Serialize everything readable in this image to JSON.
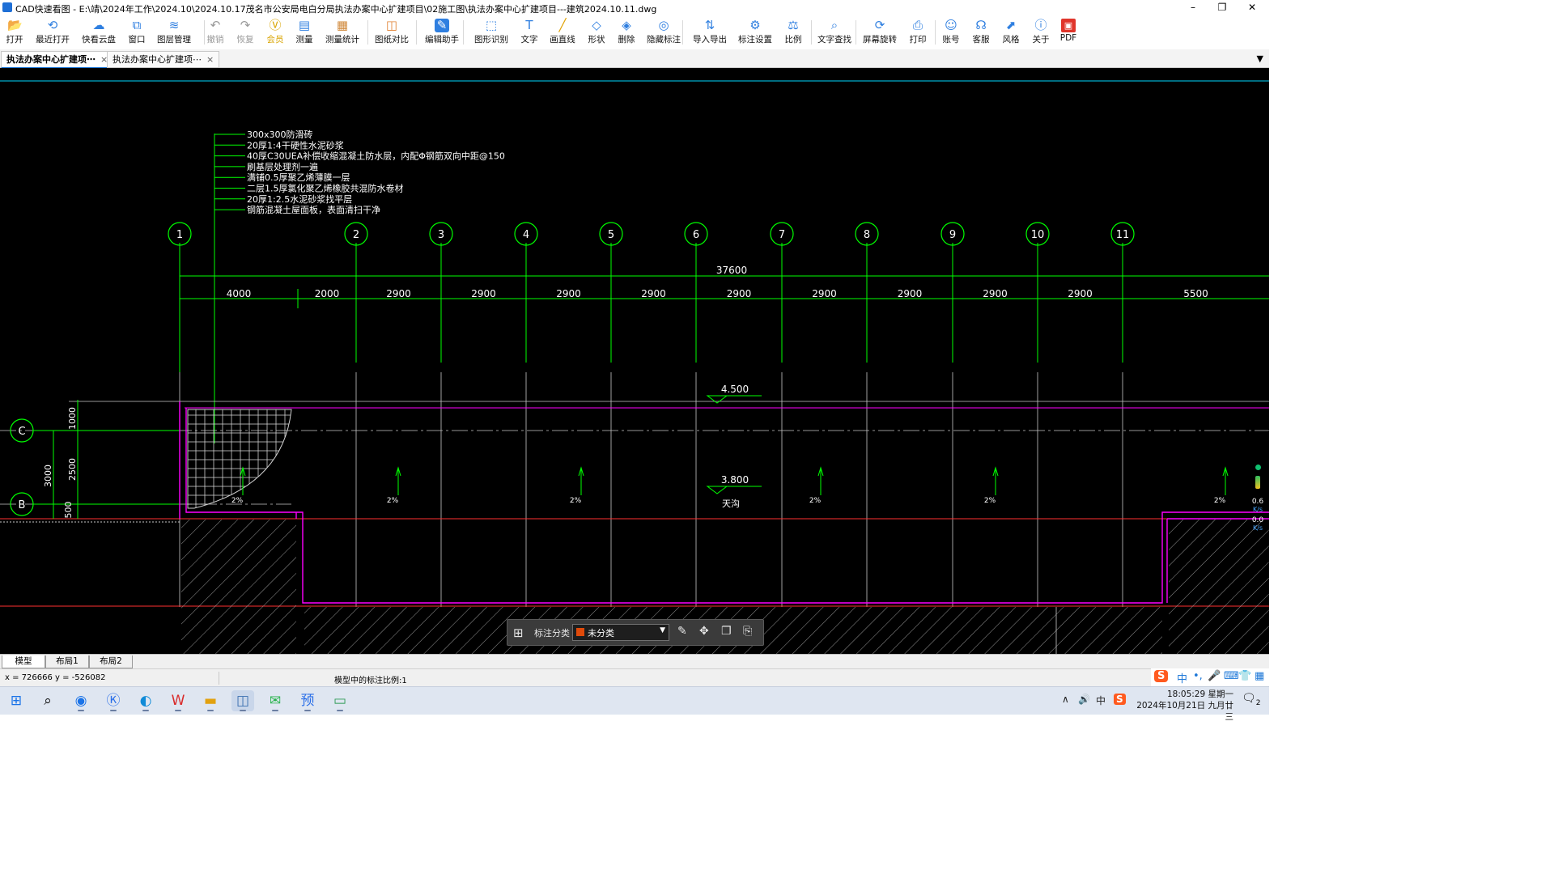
{
  "window": {
    "title": "CAD快速看图 - E:\\靖\\2024年工作\\2024.10\\2024.10.17茂名市公安局电白分局执法办案中心扩建项目\\02施工图\\执法办案中心扩建项目---建筑2024.10.11.dwg",
    "controls": {
      "minimize": "–",
      "restore": "❐",
      "close": "✕"
    }
  },
  "ribbon": {
    "buttons": [
      {
        "id": "open",
        "label": "打开",
        "icon": "folder-open-icon",
        "glyph": "📂"
      },
      {
        "id": "recent",
        "label": "最近打开",
        "icon": "history-icon",
        "glyph": "⟲"
      },
      {
        "id": "cloud",
        "label": "快看云盘",
        "icon": "cloud-icon",
        "glyph": "☁"
      },
      {
        "id": "window",
        "label": "窗口",
        "icon": "window-icon",
        "glyph": "⧉"
      },
      {
        "id": "layers",
        "label": "图层管理",
        "icon": "layers-icon",
        "glyph": "≋"
      },
      {
        "id": "undo",
        "label": "撤销",
        "icon": "undo-icon",
        "glyph": "↶"
      },
      {
        "id": "redo",
        "label": "恢复",
        "icon": "redo-icon",
        "glyph": "↷"
      },
      {
        "id": "vip",
        "label": "会员",
        "icon": "vip-icon",
        "glyph": "Ⓥ"
      },
      {
        "id": "measure",
        "label": "测量",
        "icon": "ruler-icon",
        "glyph": "▤"
      },
      {
        "id": "measure-stats",
        "label": "测量统计",
        "icon": "stats-icon",
        "glyph": "▦"
      },
      {
        "id": "compare",
        "label": "图纸对比",
        "icon": "compare-icon",
        "glyph": "◫"
      },
      {
        "id": "edit-assist",
        "label": "编辑助手",
        "icon": "edit-assist-icon",
        "glyph": "✎"
      },
      {
        "id": "shape-recog",
        "label": "图形识别",
        "icon": "shape-recognition-icon",
        "glyph": "⬚"
      },
      {
        "id": "text",
        "label": "文字",
        "icon": "text-icon",
        "glyph": "T"
      },
      {
        "id": "line",
        "label": "画直线",
        "icon": "line-icon",
        "glyph": "╱"
      },
      {
        "id": "shape",
        "label": "形状",
        "icon": "shape-icon",
        "glyph": "◇"
      },
      {
        "id": "erase",
        "label": "删除",
        "icon": "eraser-icon",
        "glyph": "◈"
      },
      {
        "id": "hide-annot",
        "label": "隐藏标注",
        "icon": "eye-hide-icon",
        "glyph": "◎"
      },
      {
        "id": "import-export",
        "label": "导入导出",
        "icon": "import-export-icon",
        "glyph": "⇅"
      },
      {
        "id": "annot-settings",
        "label": "标注设置",
        "icon": "annotation-settings-icon",
        "glyph": "⚙"
      },
      {
        "id": "scale",
        "label": "比例",
        "icon": "scale-icon",
        "glyph": "⚖"
      },
      {
        "id": "text-search",
        "label": "文字查找",
        "icon": "search-icon",
        "glyph": "⌕"
      },
      {
        "id": "rotate",
        "label": "屏幕旋转",
        "icon": "rotate-icon",
        "glyph": "⟳"
      },
      {
        "id": "print",
        "label": "打印",
        "icon": "print-icon",
        "glyph": "⎙"
      },
      {
        "id": "account",
        "label": "账号",
        "icon": "user-icon",
        "glyph": "☺"
      },
      {
        "id": "support",
        "label": "客服",
        "icon": "headset-icon",
        "glyph": "☊"
      },
      {
        "id": "style",
        "label": "风格",
        "icon": "style-icon",
        "glyph": "⬈"
      },
      {
        "id": "about",
        "label": "关于",
        "icon": "info-icon",
        "glyph": "ⓘ"
      },
      {
        "id": "pdf",
        "label": "PDF",
        "icon": "pdf-icon",
        "glyph": "▣"
      }
    ]
  },
  "doc_tabs": [
    {
      "label": "执法办案中心扩建项⋯",
      "close": "×",
      "active": true
    },
    {
      "label": "执法办案中心扩建项⋯",
      "close": "×",
      "active": false
    }
  ],
  "tab_menu_glyph": "▼",
  "drawing": {
    "layer_notes": [
      "300x300防滑砖",
      "20厚1:4干硬性水泥砂浆",
      "40厚C30UEA补偿收缩混凝土防水层，内配Φ钢筋双向中距@150",
      "刷基层处理剂一遍",
      "满铺0.5厚聚乙烯薄膜一层",
      "二层1.5厚氯化聚乙烯橡胶共混防水卷材",
      "20厚1:2.5水泥砂浆找平层",
      "钢筋混凝土屋面板，表面清扫干净"
    ],
    "axis_labels": [
      "1",
      "2",
      "3",
      "4",
      "5",
      "6",
      "7",
      "8",
      "9",
      "10",
      "11"
    ],
    "total_dim": "37600",
    "span_dims": [
      "4000",
      "2000",
      "2900",
      "2900",
      "2900",
      "2900",
      "2900",
      "2900",
      "2900",
      "2900",
      "2900",
      "5500"
    ],
    "row_axes": [
      "C",
      "B"
    ],
    "vert_dims": [
      "1000",
      "2500",
      "500",
      "3000"
    ],
    "elev_top": "4.500",
    "elev_mid": "3.800",
    "gutter_label": "天沟",
    "slope_label": "2%",
    "colors": {
      "axis": "#00ff00",
      "wall": "#ff00ff",
      "text": "#ffffff",
      "grid": "#c8c8c8",
      "red": "#ff3030",
      "cyan": "#00d8ff"
    }
  },
  "annotation_bar": {
    "label": "标注分类",
    "select_value": "未分类",
    "swatch_color": "#e04a0a",
    "dropdown_glyph": "▼",
    "tools": [
      {
        "icon": "edit-icon",
        "glyph": "✎"
      },
      {
        "icon": "move-icon",
        "glyph": "✥"
      },
      {
        "icon": "copy-icon",
        "glyph": "❐"
      },
      {
        "icon": "paste-icon",
        "glyph": "⎘"
      }
    ]
  },
  "side_widget": {
    "up": "0.6",
    "down": "0.0",
    "unit": "K/s"
  },
  "layout_tabs": [
    {
      "label": "模型",
      "active": true
    },
    {
      "label": "布局1",
      "active": false
    },
    {
      "label": "布局2",
      "active": false
    }
  ],
  "status": {
    "coords": "x = 726666  y = -526082",
    "scale_text": "模型中的标注比例:1"
  },
  "ime": {
    "logo": "S",
    "mode": "中",
    "punct": "•,",
    "mic": "🎤",
    "keyboard": "⌨",
    "shirt": "👕",
    "grid": "▦"
  },
  "taskbar": {
    "start": "⊞",
    "search": "⌕",
    "apps": [
      {
        "name": "browser-q-icon",
        "glyph": "◉"
      },
      {
        "name": "k-app-icon",
        "glyph": "Ⓚ"
      },
      {
        "name": "edge-icon",
        "glyph": "◐"
      },
      {
        "name": "wps-icon",
        "glyph": "W"
      },
      {
        "name": "file-explorer-icon",
        "glyph": "▬"
      },
      {
        "name": "cad-viewer-icon",
        "glyph": "◫"
      },
      {
        "name": "wechat-icon",
        "glyph": "✉"
      },
      {
        "name": "preview-icon",
        "glyph": "预"
      },
      {
        "name": "screen-share-icon",
        "glyph": "▭"
      }
    ],
    "tray": {
      "chevron": "∧",
      "volume": "🔊",
      "ime": "中",
      "sogou": "S"
    },
    "clock_time": "18:05:29 星期一",
    "clock_date": "2024年10月21日 九月廿三",
    "notif": "🗨",
    "notif_count": "2"
  }
}
